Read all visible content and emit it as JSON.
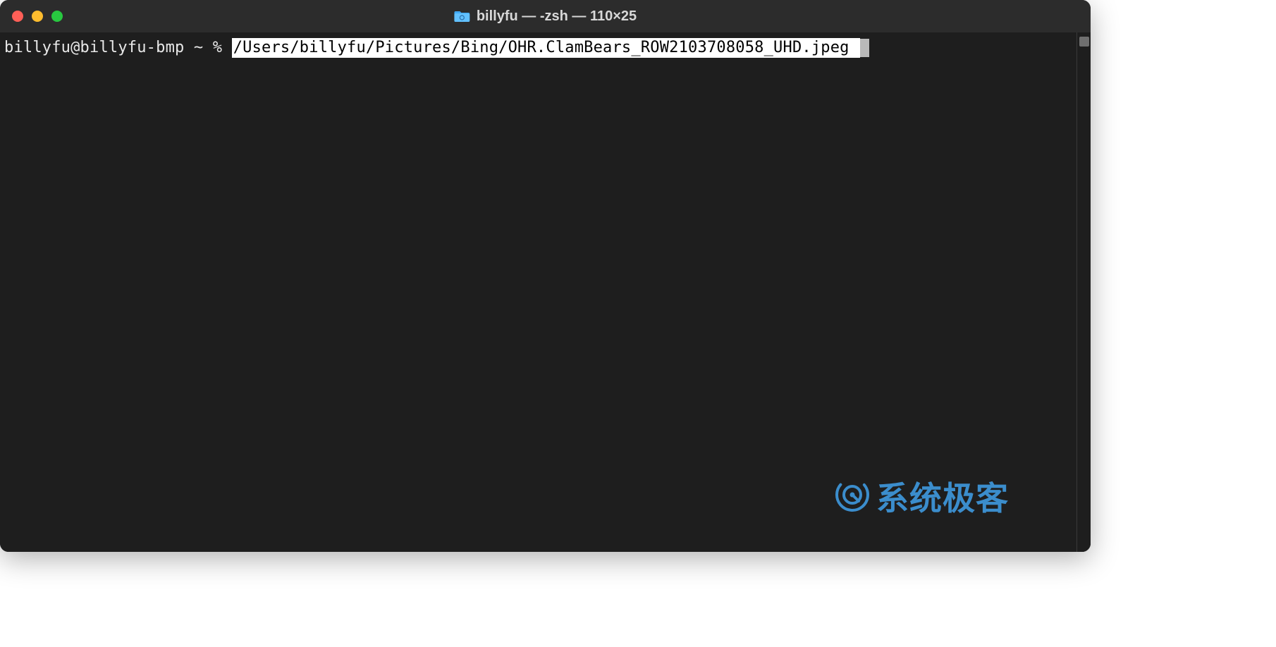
{
  "window": {
    "title": "billyfu — -zsh — 110×25"
  },
  "terminal": {
    "prompt": "billyfu@billyfu-bmp ~ % ",
    "input_selected": "/Users/billyfu/Pictures/Bing/OHR.ClamBears_ROW2103708058_UHD.jpeg "
  },
  "watermark": {
    "text": "系统极客"
  }
}
